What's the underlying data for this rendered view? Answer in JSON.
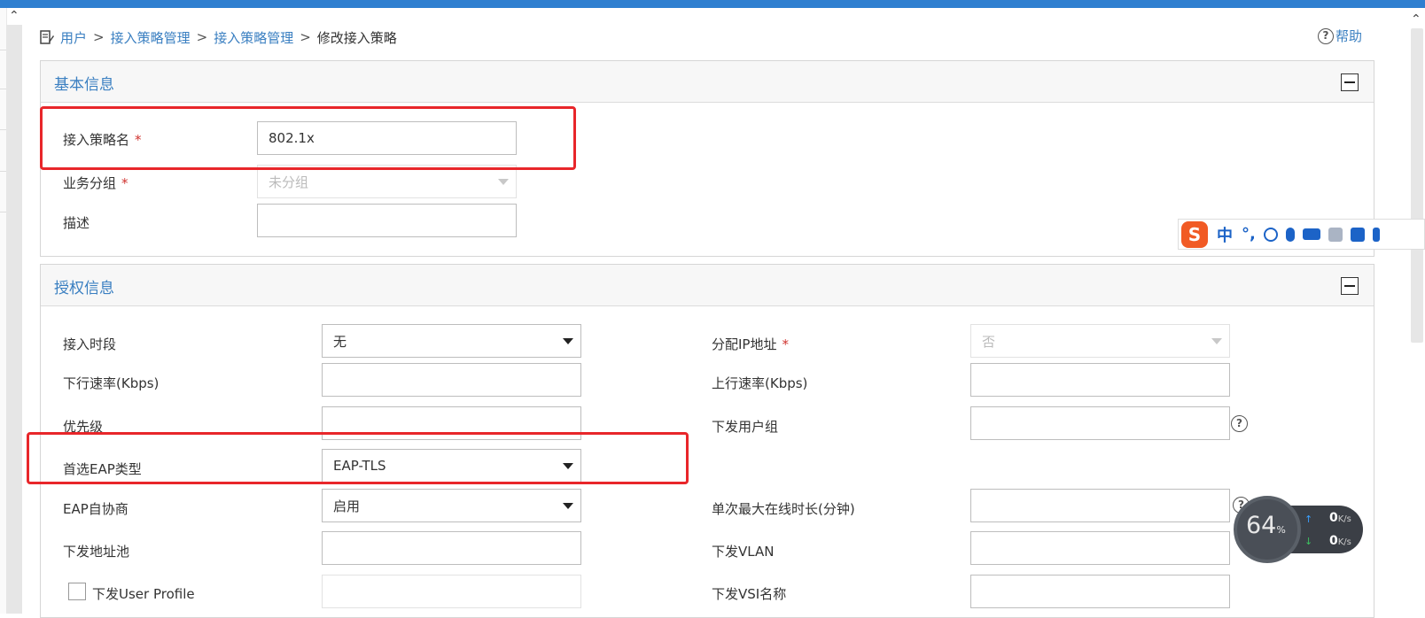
{
  "breadcrumb": {
    "items": [
      "用户",
      "接入策略管理",
      "接入策略管理"
    ],
    "separator": ">",
    "current": "修改接入策略"
  },
  "help": {
    "label": "帮助"
  },
  "basic_panel": {
    "title": "基本信息",
    "fields": {
      "name": {
        "label": "接入策略名",
        "value": "802.1x",
        "required": "*"
      },
      "group": {
        "label": "业务分组",
        "value": "未分组",
        "required": "*"
      },
      "desc": {
        "label": "描述",
        "value": ""
      }
    }
  },
  "auth_panel": {
    "title": "授权信息",
    "fields": {
      "access_period": {
        "label": "接入时段",
        "value": "无"
      },
      "assign_ip": {
        "label": "分配IP地址",
        "value": "否",
        "required": "*"
      },
      "down_rate": {
        "label": "下行速率(Kbps)",
        "value": ""
      },
      "up_rate": {
        "label": "上行速率(Kbps)",
        "value": ""
      },
      "priority": {
        "label": "优先级",
        "value": ""
      },
      "user_group": {
        "label": "下发用户组",
        "value": ""
      },
      "eap_type": {
        "label": "首选EAP类型",
        "value": "EAP-TLS"
      },
      "eap_negotiate": {
        "label": "EAP自协商",
        "value": "启用"
      },
      "max_online": {
        "label": "单次最大在线时长(分钟)",
        "value": ""
      },
      "addr_pool": {
        "label": "下发地址池",
        "value": ""
      },
      "vlan": {
        "label": "下发VLAN",
        "value": ""
      },
      "user_profile": {
        "label": "下发User Profile",
        "value": ""
      },
      "vsi": {
        "label": "下发VSI名称",
        "value": ""
      }
    }
  },
  "ime_toolbar": {
    "mode": "中",
    "punct": "°,"
  },
  "net_monitor": {
    "percent": "64",
    "percent_unit": "%",
    "up": "0",
    "down": "0",
    "unit": "K/s"
  },
  "colors": {
    "link": "#3a7fc1",
    "required": "#d0332f",
    "highlight": "#e8262a",
    "topbar": "#2f7fd0"
  }
}
